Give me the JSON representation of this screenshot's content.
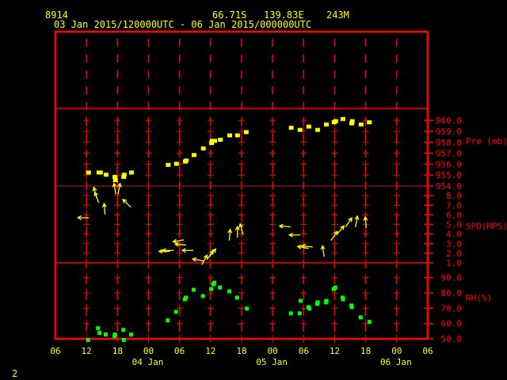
{
  "header": {
    "station_id": "8914",
    "latitude": "66.71S",
    "longitude": "139.83E",
    "elevation": "243M",
    "time_range": "03 Jan 2015/120000UTC - 06 Jan 2015/000000UTC"
  },
  "footer": {
    "page_number": "2"
  },
  "colors": {
    "frame": "#ff0000",
    "text": "#ffff00",
    "pressure": "#ffff00",
    "wind": "#ffff00",
    "rh": "#00ff00"
  },
  "chart_data": {
    "type": "scatter",
    "x_units": "hours since 03 Jan 2015 06Z",
    "x_range": [
      0,
      72
    ],
    "x_tick_labels": [
      "06",
      "12",
      "18",
      "00",
      "06",
      "12",
      "18",
      "00",
      "06",
      "12",
      "18",
      "00",
      "06"
    ],
    "x_date_labels": [
      {
        "label": "04 Jan",
        "hour": 18
      },
      {
        "label": "05 Jan",
        "hour": 42
      },
      {
        "label": "06 Jan",
        "hour": 66
      }
    ],
    "panels": [
      {
        "name": "pressure",
        "ylabel": "Pre (mb)",
        "ylim": [
          954,
          961.1
        ],
        "tick_values": [
          954,
          955,
          956,
          957,
          958,
          959,
          960
        ],
        "tick_labels": [
          "954.0",
          "955.0",
          "956.0",
          "957.0",
          "958.0",
          "959.0",
          "960.0"
        ],
        "points": [
          [
            6.4,
            955.2
          ],
          [
            8.4,
            955.2
          ],
          [
            8.7,
            955.2
          ],
          [
            9.8,
            955.0
          ],
          [
            11.5,
            954.8
          ],
          [
            11.6,
            954.5
          ],
          [
            13.2,
            954.8
          ],
          [
            13.3,
            955.0
          ],
          [
            14.7,
            955.2
          ],
          [
            21.8,
            955.9
          ],
          [
            23.4,
            956.0
          ],
          [
            25.1,
            956.2
          ],
          [
            25.3,
            956.3
          ],
          [
            26.8,
            956.8
          ],
          [
            28.6,
            957.4
          ],
          [
            30.2,
            957.9
          ],
          [
            30.3,
            958.1
          ],
          [
            30.8,
            958.1
          ],
          [
            31.9,
            958.2
          ],
          [
            33.7,
            958.6
          ],
          [
            35.2,
            958.6
          ],
          [
            36.9,
            958.9
          ],
          [
            45.6,
            959.3
          ],
          [
            47.3,
            959.1
          ],
          [
            49.0,
            959.4
          ],
          [
            50.7,
            959.1
          ],
          [
            52.4,
            959.6
          ],
          [
            53.9,
            959.8
          ],
          [
            54.2,
            959.9
          ],
          [
            55.6,
            960.1
          ],
          [
            57.3,
            959.7
          ],
          [
            57.4,
            959.9
          ],
          [
            59.1,
            959.6
          ],
          [
            60.7,
            959.8
          ]
        ]
      },
      {
        "name": "wind",
        "ylabel": "SPD(MPS)",
        "ylim": [
          1,
          9
        ],
        "tick_values": [
          1,
          2,
          3,
          4,
          5,
          6,
          7,
          8
        ],
        "tick_labels": [
          "1.0",
          "2.0",
          "3.0",
          "4.0",
          "5.0",
          "6.0",
          "7.0",
          "8.0"
        ],
        "points_hour_speed_direction": [
          [
            5.4,
            5.7,
            90
          ],
          [
            7.7,
            8.3,
            165
          ],
          [
            8.0,
            7.8,
            160
          ],
          [
            9.5,
            6.6,
            175
          ],
          [
            11.5,
            8.7,
            170
          ],
          [
            12.3,
            8.7,
            190
          ],
          [
            13.8,
            7.2,
            135
          ],
          [
            21.1,
            2.2,
            90
          ],
          [
            21.8,
            2.3,
            90
          ],
          [
            23.8,
            3.3,
            80
          ],
          [
            24.2,
            2.9,
            95
          ],
          [
            25.6,
            2.3,
            90
          ],
          [
            27.6,
            1.3,
            100
          ],
          [
            28.8,
            1.3,
            210
          ],
          [
            29.9,
            1.8,
            215
          ],
          [
            30.3,
            2.0,
            220
          ],
          [
            33.7,
            3.9,
            185
          ],
          [
            35.2,
            4.2,
            180
          ],
          [
            36.0,
            4.5,
            165
          ],
          [
            44.4,
            4.8,
            95
          ],
          [
            46.3,
            3.9,
            90
          ],
          [
            47.9,
            2.6,
            100
          ],
          [
            48.7,
            2.7,
            95
          ],
          [
            51.8,
            2.2,
            170
          ],
          [
            53.9,
            3.8,
            215
          ],
          [
            55.1,
            4.4,
            220
          ],
          [
            56.7,
            5.2,
            215
          ],
          [
            58.2,
            5.3,
            190
          ],
          [
            60.0,
            5.2,
            175
          ]
        ]
      },
      {
        "name": "relative_humidity",
        "ylabel": "RH(%)",
        "ylim": [
          50,
          99.7
        ],
        "tick_values": [
          50,
          60,
          70,
          80,
          90
        ],
        "tick_labels": [
          "50.0",
          "60.0",
          "70.0",
          "80.0",
          "90.0"
        ],
        "points": [
          [
            6.4,
            49.0
          ],
          [
            8.3,
            56.7
          ],
          [
            8.6,
            53.6
          ],
          [
            9.8,
            52.6
          ],
          [
            11.6,
            52.6
          ],
          [
            11.5,
            51.5
          ],
          [
            13.2,
            55.6
          ],
          [
            13.3,
            49.0
          ],
          [
            14.7,
            52.6
          ],
          [
            21.8,
            61.8
          ],
          [
            23.4,
            67.4
          ],
          [
            25.1,
            75.6
          ],
          [
            25.3,
            76.7
          ],
          [
            26.8,
            81.8
          ],
          [
            28.6,
            77.7
          ],
          [
            30.2,
            82.3
          ],
          [
            30.6,
            85.4
          ],
          [
            30.8,
            86.4
          ],
          [
            31.9,
            83.3
          ],
          [
            33.7,
            80.8
          ],
          [
            35.2,
            76.7
          ],
          [
            37.1,
            69.5
          ],
          [
            45.6,
            66.4
          ],
          [
            47.3,
            66.4
          ],
          [
            47.5,
            74.6
          ],
          [
            49.0,
            70.5
          ],
          [
            49.2,
            69.5
          ],
          [
            50.7,
            72.6
          ],
          [
            50.8,
            73.6
          ],
          [
            52.4,
            73.6
          ],
          [
            52.5,
            74.6
          ],
          [
            53.9,
            82.3
          ],
          [
            54.2,
            83.3
          ],
          [
            55.6,
            76.7
          ],
          [
            55.7,
            75.6
          ],
          [
            57.3,
            71.5
          ],
          [
            57.4,
            70.5
          ],
          [
            59.1,
            63.8
          ],
          [
            60.8,
            60.8
          ]
        ]
      }
    ]
  }
}
